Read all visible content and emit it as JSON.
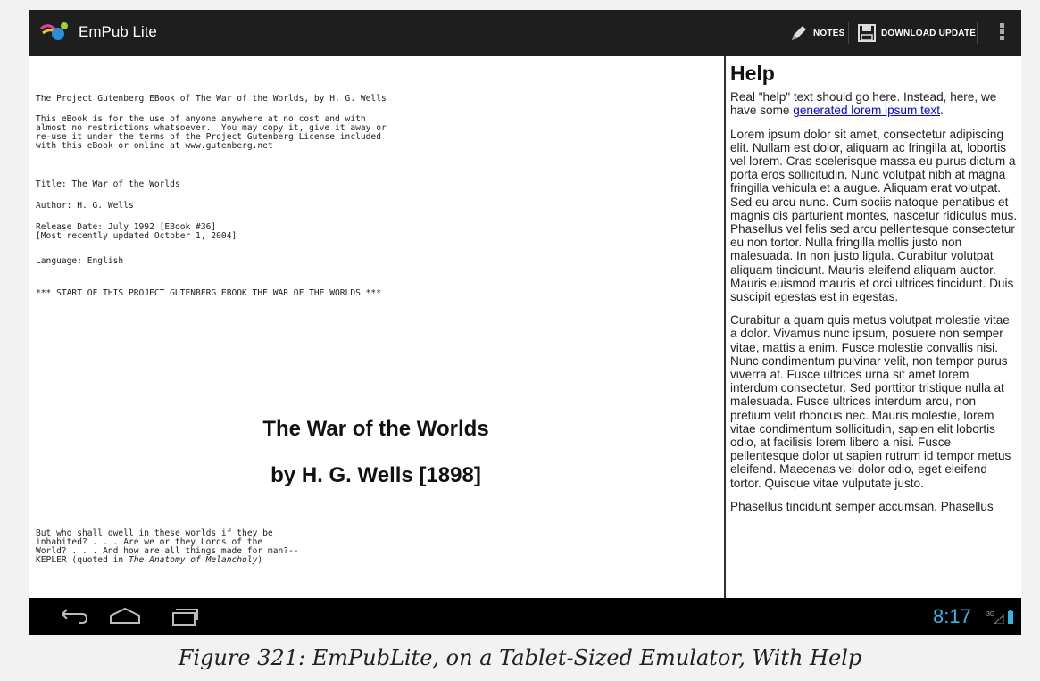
{
  "app": {
    "title": "EmPub Lite",
    "icon": "empub-logo-icon"
  },
  "actions": {
    "notes_label": "NOTES",
    "download_label": "DOWNLOAD UPDATE",
    "overflow_icon": "overflow-menu-icon"
  },
  "book": {
    "header": "The Project Gutenberg EBook of The War of the Worlds, by H. G. Wells",
    "license": "This eBook is for the use of anyone anywhere at no cost and with\nalmost no restrictions whatsoever.  You may copy it, give it away or\nre-use it under the terms of the Project Gutenberg License included\nwith this eBook or online at www.gutenberg.net",
    "title_line": "Title: The War of the Worlds",
    "author_line": "Author: H. G. Wells",
    "release_line": "Release Date: July 1992 [EBook #36]\n[Most recently updated October 1, 2004]",
    "language_line": "Language: English",
    "start_line": "*** START OF THIS PROJECT GUTENBERG EBOOK THE WAR OF THE WORLDS ***",
    "main_title": "The War of the Worlds",
    "byline": "by H. G. Wells [1898]",
    "epigraph": "But who shall dwell in these worlds if they be\ninhabited? . . . Are we or they Lords of the\nWorld? . . . And how are all things made for man?--\nKEPLER (quoted in ",
    "epigraph_em": "The Anatomy of Melancholy",
    "epigraph_end": ")"
  },
  "help": {
    "heading": "Help",
    "intro": "Real \"help\" text should go here. Instead, here, we have some ",
    "intro_link": "generated lorem ipsum text",
    "intro_end": ".",
    "para1": "Lorem ipsum dolor sit amet, consectetur adipiscing elit. Nullam est dolor, aliquam ac fringilla at, lobortis vel lorem. Cras scelerisque massa eu purus dictum a porta eros sollicitudin. Nunc volutpat nibh at magna fringilla vehicula et a augue. Aliquam erat volutpat. Sed eu arcu nunc. Cum sociis natoque penatibus et magnis dis parturient montes, nascetur ridiculus mus. Phasellus vel felis sed arcu pellentesque consectetur eu non tortor. Nulla fringilla mollis justo non malesuada. In non justo ligula. Curabitur volutpat aliquam tincidunt. Mauris eleifend aliquam auctor. Mauris euismod mauris et orci ultrices tincidunt. Duis suscipit egestas est in egestas.",
    "para2": "Curabitur a quam quis metus volutpat molestie vitae a dolor. Vivamus nunc ipsum, posuere non semper vitae, mattis a enim. Fusce molestie convallis nisi. Nunc condimentum pulvinar velit, non tempor purus viverra at. Fusce ultrices urna sit amet lorem interdum consectetur. Sed porttitor tristique nulla at malesuada. Fusce ultrices interdum arcu, non pretium velit rhoncus nec. Mauris molestie, lorem vitae condimentum sollicitudin, sapien elit lobortis odio, at facilisis lorem libero a nisi. Fusce pellentesque dolor ut sapien rutrum id tempor metus eleifend. Maecenas vel dolor odio, eget eleifend tortor. Quisque vitae vulputate justo.",
    "para3": "Phasellus tincidunt semper accumsan. Phasellus"
  },
  "system": {
    "time": "8:17",
    "network": "3G",
    "accent": "#33b5e5"
  },
  "caption": "Figure 321: EmPubLite, on a Tablet-Sized Emulator, With Help"
}
